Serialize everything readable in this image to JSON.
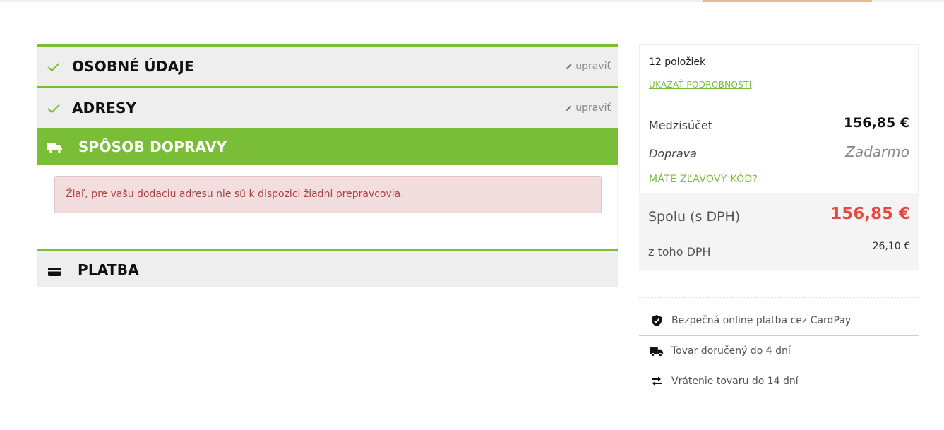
{
  "steps": {
    "personal": {
      "title": "OSOBNÉ ÚDAJE",
      "edit_label": "upraviť"
    },
    "addresses": {
      "title": "ADRESY",
      "edit_label": "upraviť"
    },
    "shipping": {
      "title": "SPÔSOB DOPRAVY",
      "alert": "Žiaľ, pre vašu dodaciu adresu nie sú k dispozici žiadni prepravcovia."
    },
    "payment": {
      "title": "PLATBA"
    }
  },
  "summary": {
    "items_count": "12 položiek",
    "show_details": "UKÁZAŤ PODROBNOSTI",
    "subtotal_label": "Medzisúčet",
    "subtotal_value": "156,85 €",
    "shipping_label": "Doprava",
    "shipping_value": "Zadarmo",
    "discount_link": "MÁTE ZĽAVOVÝ KÓD?",
    "total_label": "Spolu (s DPH)",
    "total_value": "156,85 €",
    "vat_label": "z toho DPH",
    "vat_value": "26,10 €"
  },
  "benefits": [
    {
      "icon": "shield-check-icon",
      "text": "Bezpečná online platba cez CardPay"
    },
    {
      "icon": "truck-icon",
      "text": "Tovar doručený do 4 dní"
    },
    {
      "icon": "exchange-arrows-icon",
      "text": "Vrátenie tovaru do 14 dní"
    }
  ],
  "colors": {
    "accent": "#7abe38",
    "total": "#e8493f",
    "alert_bg": "#f2dede",
    "alert_text": "#a94442"
  }
}
